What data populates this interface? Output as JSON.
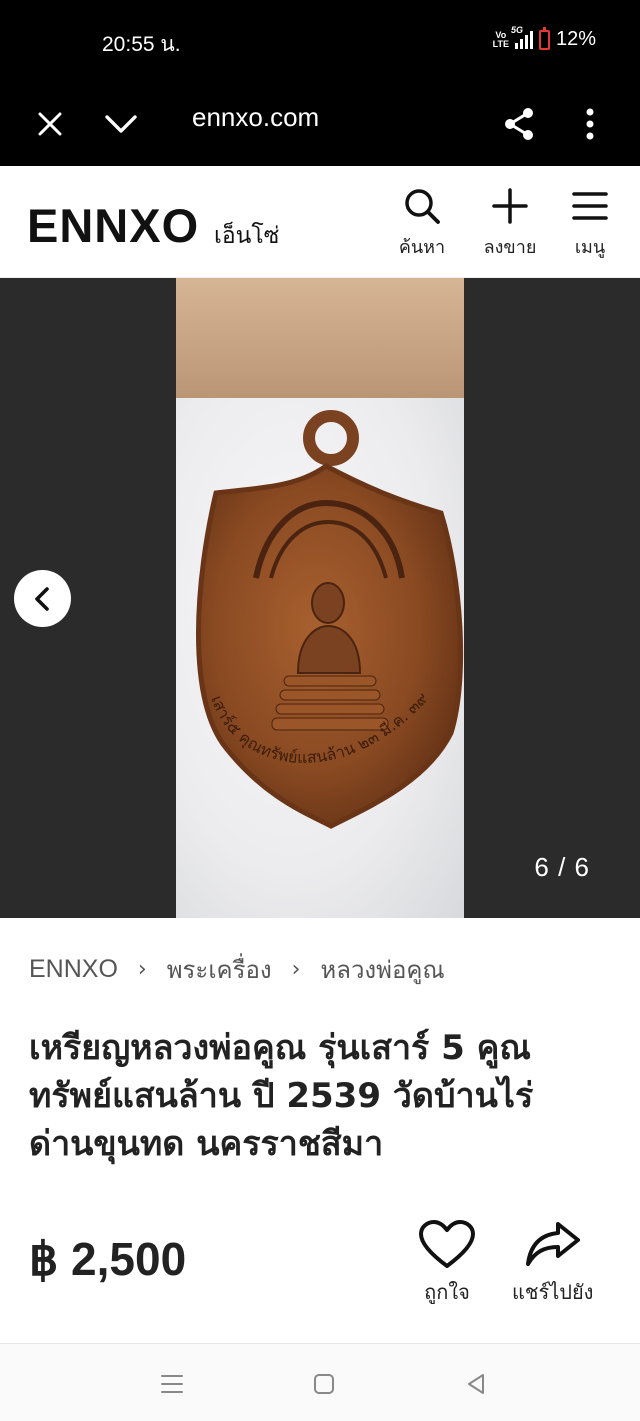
{
  "status_bar": {
    "time": "20:55 น.",
    "volte": "Vo\nLTE",
    "network": "5G",
    "battery": "12%"
  },
  "browser": {
    "url": "ennxo.com",
    "icons": [
      "close-icon",
      "chevron-down-icon",
      "share-icon",
      "more-vert-icon"
    ]
  },
  "header": {
    "logo": "ENNXO",
    "logo_thai": "เอ็นโซ่",
    "search_label": "ค้นหา",
    "sell_label": "ลงขาย",
    "menu_label": "เมนู"
  },
  "carousel": {
    "counter": "6 / 6"
  },
  "medal": {
    "inscription": "เสาร์๕ คุณทรัพย์แสนล้าน ๒๓ มี.ค. ๓๙"
  },
  "breadcrumb": {
    "items": [
      "ENNXO",
      "พระเครื่อง",
      "หลวงพ่อคูณ"
    ]
  },
  "listing": {
    "title": "เหรียญหลวงพ่อคูณ รุ่นเสาร์ 5 คูณทรัพย์แสนล้าน ปี 2539 วัดบ้านไร่ ด่านขุนทด นครราชสีมา",
    "price": "฿ 2,500",
    "like_label": "ถูกใจ",
    "share_label": "แชร์ไปยัง"
  },
  "colors": {
    "black_bar": "#000000",
    "medal_bronze": "#8a4a22",
    "battery_red": "#e53935"
  }
}
